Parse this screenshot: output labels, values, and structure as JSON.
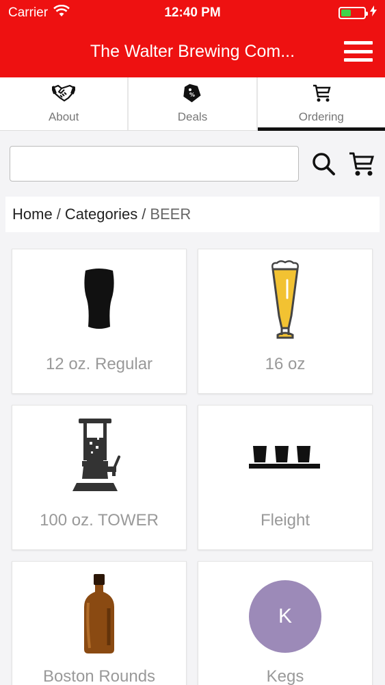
{
  "status": {
    "carrier": "Carrier",
    "time": "12:40 PM",
    "battery_level": 0.45
  },
  "header": {
    "title": "The Walter Brewing Com...",
    "menu_icon": "hamburger-menu-icon"
  },
  "tabs": [
    {
      "label": "About",
      "icon": "handshake-icon",
      "active": false
    },
    {
      "label": "Deals",
      "icon": "tag-percent-icon",
      "active": false
    },
    {
      "label": "Ordering",
      "icon": "cart-icon",
      "active": true
    }
  ],
  "search": {
    "value": "",
    "placeholder": ""
  },
  "breadcrumb": {
    "home": "Home",
    "categories": "Categories",
    "current": "BEER",
    "separator": "/"
  },
  "categories": [
    {
      "label": "12 oz. Regular",
      "icon": "pint-glass-icon"
    },
    {
      "label": "16 oz",
      "icon": "pilsner-glass-icon"
    },
    {
      "label": "100 oz. TOWER",
      "icon": "beer-tower-icon"
    },
    {
      "label": "Fleight",
      "icon": "flight-glasses-icon"
    },
    {
      "label": "Boston Rounds",
      "icon": "amber-bottle-icon"
    },
    {
      "label": "Kegs",
      "icon": "letter-avatar",
      "avatar_letter": "K"
    }
  ],
  "colors": {
    "header_red": "#ee1111",
    "avatar_purple": "#9c8ab8"
  }
}
